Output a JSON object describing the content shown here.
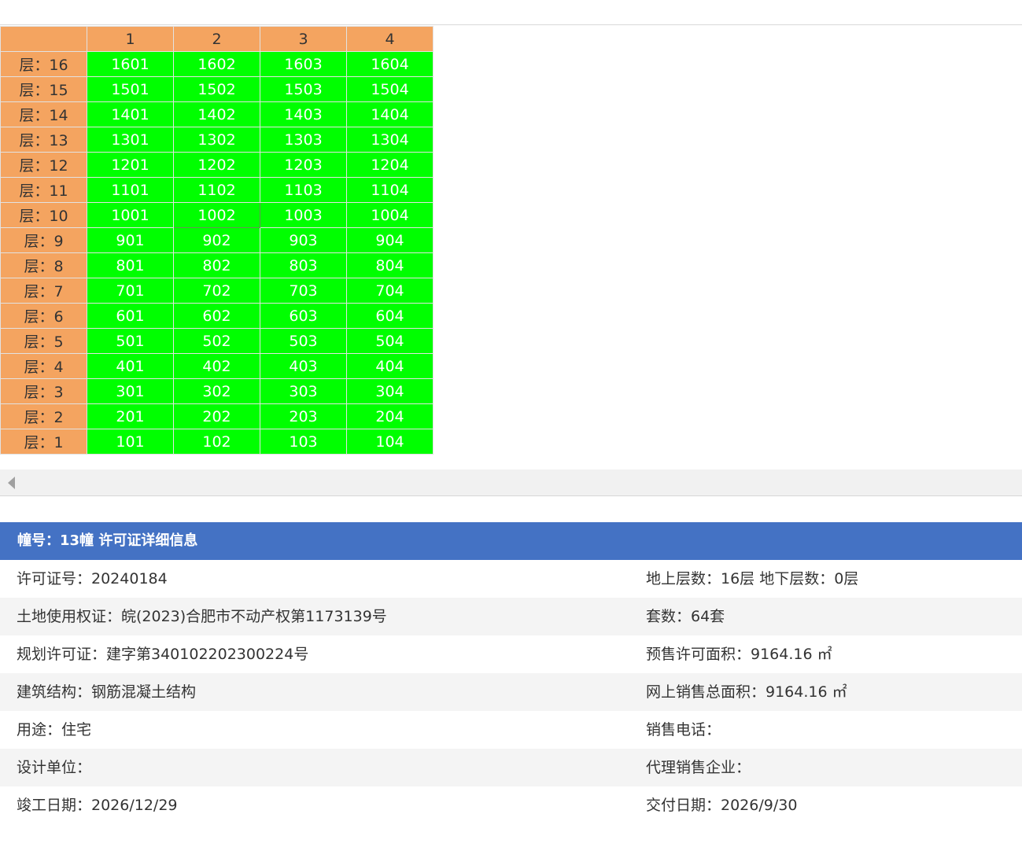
{
  "grid": {
    "columns": [
      "",
      "1",
      "2",
      "3",
      "4"
    ],
    "floors": [
      {
        "label": "层：16",
        "units": [
          "1601",
          "1602",
          "1603",
          "1604"
        ]
      },
      {
        "label": "层：15",
        "units": [
          "1501",
          "1502",
          "1503",
          "1504"
        ]
      },
      {
        "label": "层：14",
        "units": [
          "1401",
          "1402",
          "1403",
          "1404"
        ]
      },
      {
        "label": "层：13",
        "units": [
          "1301",
          "1302",
          "1303",
          "1304"
        ]
      },
      {
        "label": "层：12",
        "units": [
          "1201",
          "1202",
          "1203",
          "1204"
        ]
      },
      {
        "label": "层：11",
        "units": [
          "1101",
          "1102",
          "1103",
          "1104"
        ]
      },
      {
        "label": "层：10",
        "units": [
          "1001",
          "1002",
          "1003",
          "1004"
        ]
      },
      {
        "label": "层：9",
        "units": [
          "901",
          "902",
          "903",
          "904"
        ]
      },
      {
        "label": "层：8",
        "units": [
          "801",
          "802",
          "803",
          "804"
        ]
      },
      {
        "label": "层：7",
        "units": [
          "701",
          "702",
          "703",
          "704"
        ]
      },
      {
        "label": "层：6",
        "units": [
          "601",
          "602",
          "603",
          "604"
        ]
      },
      {
        "label": "层：5",
        "units": [
          "501",
          "502",
          "503",
          "504"
        ]
      },
      {
        "label": "层：4",
        "units": [
          "401",
          "402",
          "403",
          "404"
        ]
      },
      {
        "label": "层：3",
        "units": [
          "301",
          "302",
          "303",
          "304"
        ]
      },
      {
        "label": "层：2",
        "units": [
          "201",
          "202",
          "203",
          "204"
        ]
      },
      {
        "label": "层：1",
        "units": [
          "101",
          "102",
          "103",
          "104"
        ]
      }
    ]
  },
  "colors": {
    "floor_header": "#f4a460",
    "unit_available": "#00ff00",
    "title_bar": "#4472c4"
  },
  "info": {
    "title": "幢号：13幢 许可证详细信息",
    "rows": [
      {
        "left": "许可证号：20240184",
        "right": "地上层数：16层  地下层数：0层"
      },
      {
        "left": "土地使用权证：皖(2023)合肥市不动产权第1173139号",
        "right": "套数：64套"
      },
      {
        "left": "规划许可证：建字第340102202300224号",
        "right": "预售许可面积：9164.16 ㎡"
      },
      {
        "left": "建筑结构：钢筋混凝土结构",
        "right": "网上销售总面积：9164.16 ㎡"
      },
      {
        "left": "用途：住宅",
        "right": "销售电话："
      },
      {
        "left": "设计单位：",
        "right": "代理销售企业："
      },
      {
        "left": "竣工日期：2026/12/29",
        "right": "交付日期：2026/9/30"
      }
    ]
  }
}
